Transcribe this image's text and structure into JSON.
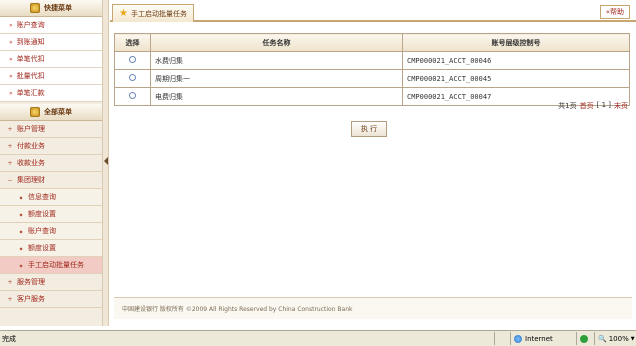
{
  "sidebar": {
    "quick_menu_title": "快捷菜单",
    "quick_items": [
      "账户查询",
      "到账通知",
      "单笔代扣",
      "批量代扣",
      "单笔汇款"
    ],
    "all_menu_title": "全部菜单",
    "all_items": [
      {
        "label": "账户管理",
        "expanded": false
      },
      {
        "label": "付款业务",
        "expanded": false
      },
      {
        "label": "收款业务",
        "expanded": false
      },
      {
        "label": "集团理财",
        "expanded": true
      }
    ],
    "sub_items": [
      "信息查询",
      "额度设置",
      "账户查询",
      "额度设置",
      "手工启动批量任务"
    ],
    "bottom_items": [
      {
        "label": "服务管理"
      },
      {
        "label": "客户服务"
      }
    ]
  },
  "tab": {
    "title": "手工启动批量任务"
  },
  "help_label": "«帮助",
  "table": {
    "headers": [
      "选择",
      "任务名称",
      "账号层级控制号"
    ],
    "rows": [
      {
        "name": "水费归集",
        "code": "CMP000021_ACCT_00046"
      },
      {
        "name": "周期归集一",
        "code": "CMP000021_ACCT_00045"
      },
      {
        "name": "电费归集",
        "code": "CMP000021_ACCT_00047"
      }
    ]
  },
  "pager": {
    "total": "共1页",
    "first": "首页",
    "page_input": "[ 1 ]",
    "last": "末页"
  },
  "execute_label": "执 行",
  "footer_text": "中国建设银行 版权所有 ©2009 All Rights Reserved by China Construction Bank",
  "statusbar": {
    "status": "完成",
    "zone": "Internet",
    "zoom": "100%"
  }
}
